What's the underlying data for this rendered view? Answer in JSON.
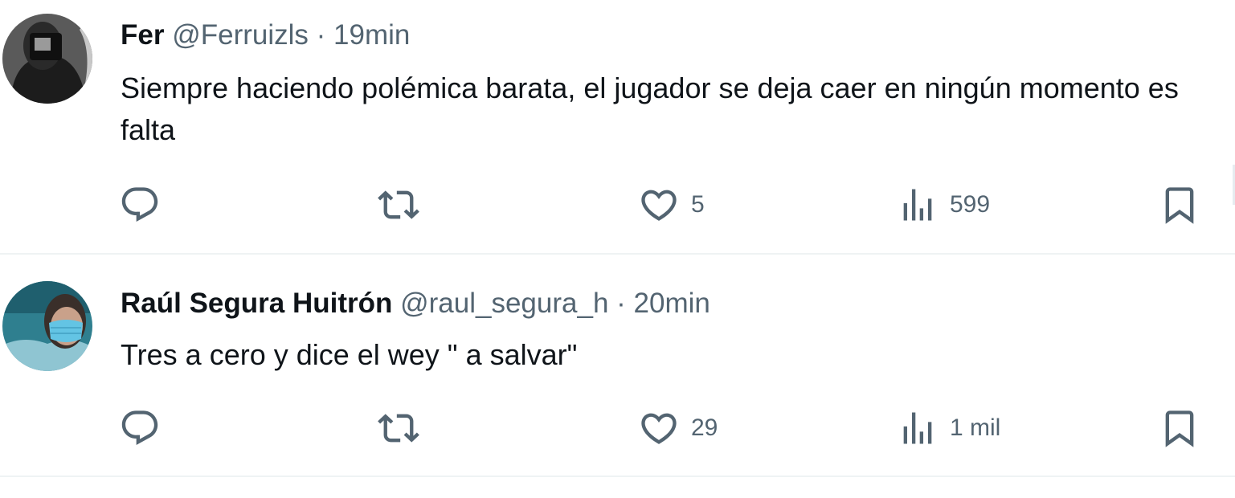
{
  "tweets": [
    {
      "display_name": "Fer",
      "handle": "@Ferruizls",
      "separator": "·",
      "time": "19min",
      "text": "Siempre haciendo polémica barata, el jugador se deja caer en ningún momento es falta",
      "likes": "5",
      "views": "599",
      "avatar": {
        "icon": "avatar-photo-dark",
        "colors": [
          "#3a3a3a",
          "#1a1a1a",
          "#8a8a8a"
        ]
      }
    },
    {
      "display_name": "Raúl Segura Huitrón",
      "handle": "@raul_segura_h",
      "separator": "·",
      "time": "20min",
      "text": "Tres a cero y dice el wey \" a salvar\"",
      "likes": "29",
      "views": "1 mil",
      "avatar": {
        "icon": "avatar-photo-masked",
        "colors": [
          "#2b6f7d",
          "#63c4e4",
          "#9ed1dd"
        ]
      }
    }
  ],
  "icons": {
    "reply": "reply-icon",
    "repost": "repost-icon",
    "like": "heart-icon",
    "views": "views-icon",
    "bookmark": "bookmark-icon"
  },
  "colors": {
    "text_primary": "#0f1419",
    "text_secondary": "#536471",
    "divider": "#eff3f4",
    "background": "#ffffff"
  }
}
